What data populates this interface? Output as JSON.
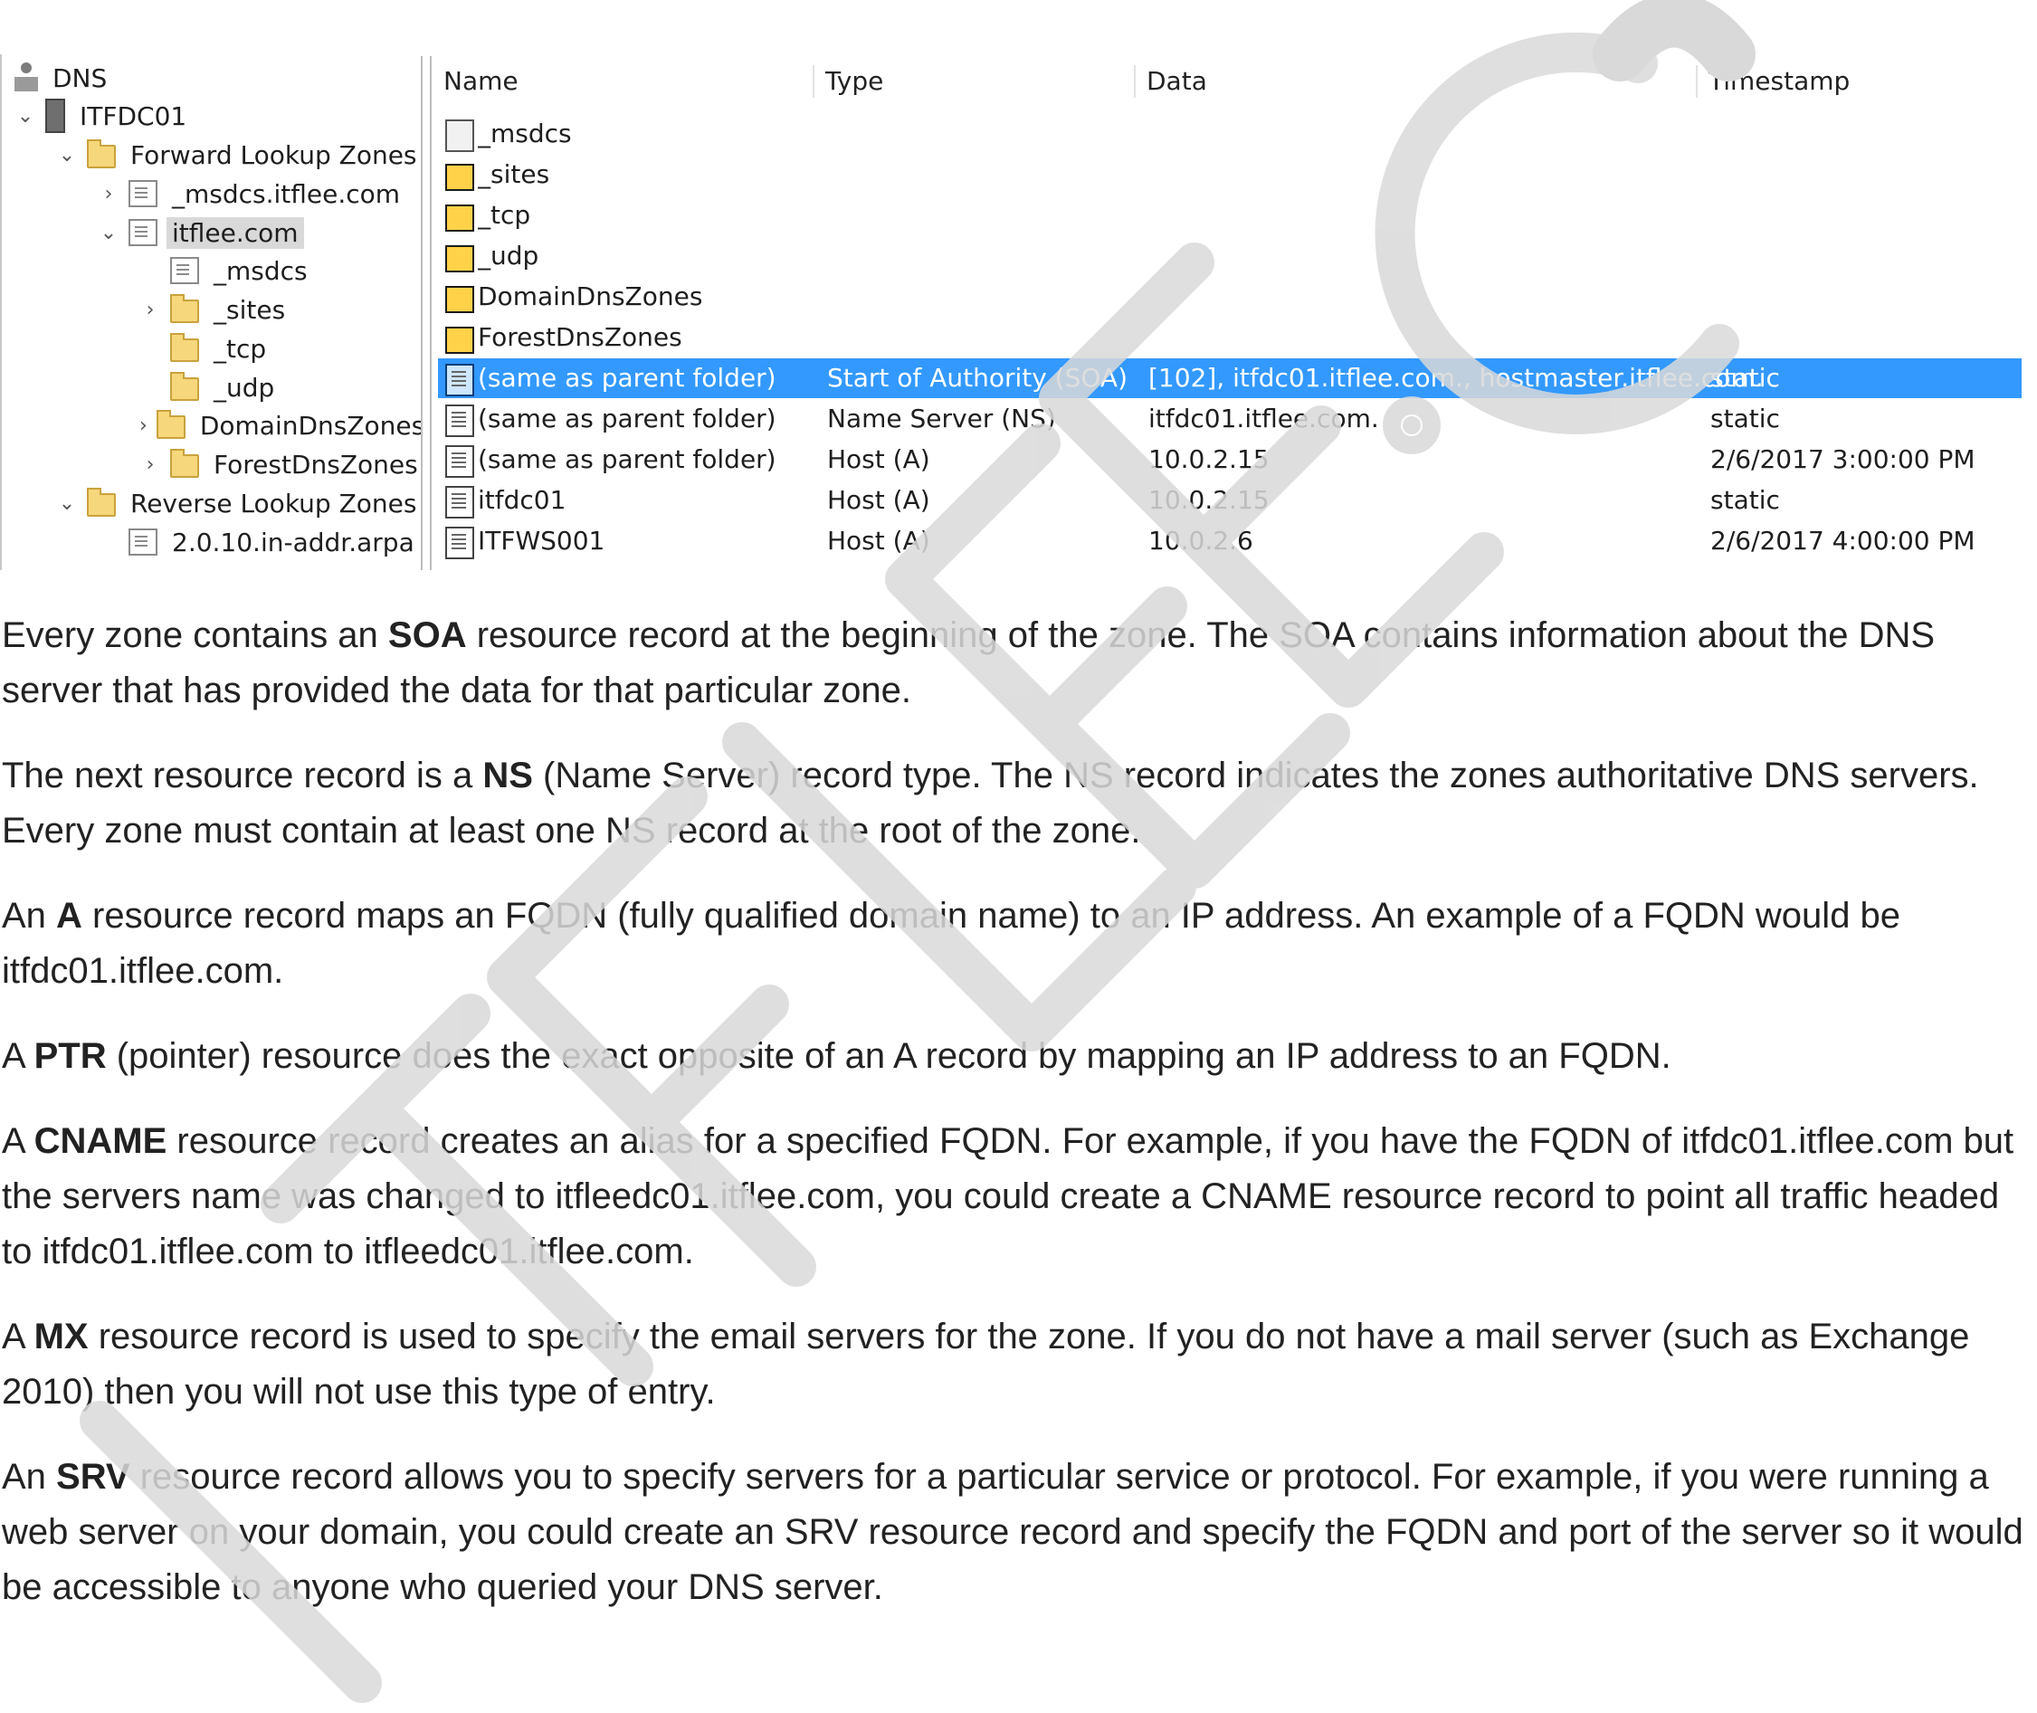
{
  "tree": {
    "root": "DNS",
    "server": "ITFDC01",
    "forward_lookup_zones": "Forward Lookup Zones",
    "zone_msdcs_itflee": "_msdcs.itflee.com",
    "zone_itflee": "itflee.com",
    "child_msdcs": "_msdcs",
    "child_sites": "_sites",
    "child_tcp": "_tcp",
    "child_udp": "_udp",
    "child_domaindnszones": "DomainDnsZones",
    "child_forestdnszones": "ForestDnsZones",
    "reverse_lookup_zones": "Reverse Lookup Zones",
    "reverse_zone": "2.0.10.in-addr.arpa"
  },
  "grid": {
    "columns": [
      "Name",
      "Type",
      "Data",
      "Timestamp"
    ],
    "rows": [
      {
        "name": "_msdcs",
        "type": "",
        "data": "",
        "timestamp": "",
        "icon": "zone-icon"
      },
      {
        "name": "_sites",
        "type": "",
        "data": "",
        "timestamp": "",
        "icon": "folder-icon"
      },
      {
        "name": "_tcp",
        "type": "",
        "data": "",
        "timestamp": "",
        "icon": "folder-icon"
      },
      {
        "name": "_udp",
        "type": "",
        "data": "",
        "timestamp": "",
        "icon": "folder-icon"
      },
      {
        "name": "DomainDnsZones",
        "type": "",
        "data": "",
        "timestamp": "",
        "icon": "folder-icon"
      },
      {
        "name": "ForestDnsZones",
        "type": "",
        "data": "",
        "timestamp": "",
        "icon": "folder-icon"
      },
      {
        "name": "(same as parent folder)",
        "type": "Start of Authority (SOA)",
        "data": "[102], itfdc01.itflee.com., hostmaster.itflee.com.",
        "timestamp": "static",
        "icon": "record-icon",
        "selected": true
      },
      {
        "name": "(same as parent folder)",
        "type": "Name Server (NS)",
        "data": "itfdc01.itflee.com.",
        "timestamp": "static",
        "icon": "record-icon"
      },
      {
        "name": "(same as parent folder)",
        "type": "Host (A)",
        "data": "10.0.2.15",
        "timestamp": "2/6/2017 3:00:00 PM",
        "icon": "record-icon"
      },
      {
        "name": "itfdc01",
        "type": "Host (A)",
        "data": "10.0.2.15",
        "timestamp": "static",
        "icon": "record-icon"
      },
      {
        "name": "ITFWS001",
        "type": "Host (A)",
        "data": "10.0.2.6",
        "timestamp": "2/6/2017 4:00:00 PM",
        "icon": "record-icon"
      }
    ]
  },
  "paragraphs": [
    {
      "parts": [
        {
          "t": "Every zone contains an "
        },
        {
          "t": "SOA",
          "b": true
        },
        {
          "t": " resource record at the beginning of the zone. The SOA contains information about the DNS server that has provided the data for that particular zone."
        }
      ]
    },
    {
      "parts": [
        {
          "t": "The next resource record is a "
        },
        {
          "t": "NS",
          "b": true
        },
        {
          "t": " (Name Server) record type. The NS record indicates the zones authoritative DNS servers. Every zone must contain at least one NS record at the root of the zone."
        }
      ]
    },
    {
      "parts": [
        {
          "t": "An "
        },
        {
          "t": "A",
          "b": true
        },
        {
          "t": " resource record maps an FQDN (fully qualified domain name) to an IP address. An example of a FQDN would be itfdc01.itflee.com."
        }
      ]
    },
    {
      "parts": [
        {
          "t": "A "
        },
        {
          "t": "PTR",
          "b": true
        },
        {
          "t": " (pointer) resource does the exact opposite of an A record by mapping an IP address to an FQDN."
        }
      ]
    },
    {
      "parts": [
        {
          "t": "A "
        },
        {
          "t": "CNAME",
          "b": true
        },
        {
          "t": " resource record creates an alias for a specified FQDN. For example, if you have the FQDN of itfdc01.itflee.com but the servers name was changed to itfleedc01.itflee.com, you could create a CNAME resource record to point all traffic headed to itfdc01.itflee.com to itfleedc01.itflee.com."
        }
      ]
    },
    {
      "parts": [
        {
          "t": "A "
        },
        {
          "t": "MX",
          "b": true
        },
        {
          "t": " resource record is used to specify the email servers for the zone. If you do not have a mail server (such as Exchange 2010) then you will not use this type of entry."
        }
      ]
    },
    {
      "parts": [
        {
          "t": "An "
        },
        {
          "t": "SRV",
          "b": true
        },
        {
          "t": " resource record allows you to specify servers for a particular service or protocol. For example, if you were running a web server on your domain, you could create an SRV resource record and specify the FQDN and port of the server so it would be accessible to anyone who queried your DNS server."
        }
      ]
    }
  ],
  "watermark": {
    "text": "ITFLEE.C",
    "color": "#d9d9d9"
  },
  "colors": {
    "selection": "#3399ff",
    "tree_selection": "#d9d9d9"
  }
}
